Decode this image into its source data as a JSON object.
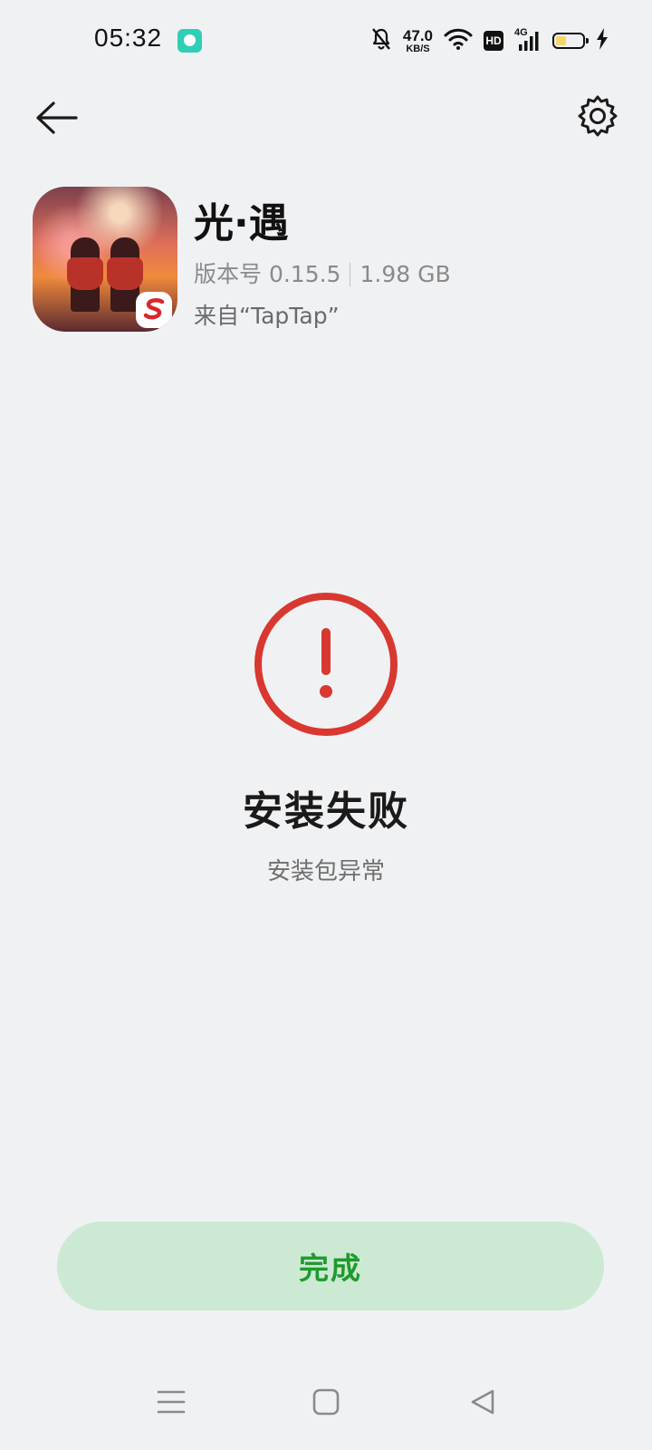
{
  "status_bar": {
    "time": "05:32",
    "net_speed_value": "47.0",
    "net_speed_unit": "KB/S",
    "hd_label": "HD",
    "network_type": "4G",
    "battery_level": 0.35,
    "icons": [
      "chat-app-notification-icon",
      "bell-muted-icon",
      "wifi-icon",
      "hd-icon",
      "cellular-signal-icon",
      "battery-icon",
      "charging-bolt-icon"
    ]
  },
  "top_bar": {
    "back_icon": "arrow-left-icon",
    "settings_icon": "gear-icon"
  },
  "app": {
    "name": "光·遇",
    "version": "版本号 0.15.5",
    "size": "1.98 GB",
    "source": "来自“TapTap”"
  },
  "result": {
    "icon": "error-exclamation-icon",
    "title": "安装失败",
    "subtitle": "安装包异常",
    "accent_color": "#d8382f"
  },
  "actions": {
    "done_label": "完成",
    "done_text_color": "#1e9a2c",
    "done_bg_color": "#cce9d3"
  },
  "nav_bar": {
    "icons": [
      "menu-icon",
      "home-square-icon",
      "back-triangle-icon"
    ]
  }
}
